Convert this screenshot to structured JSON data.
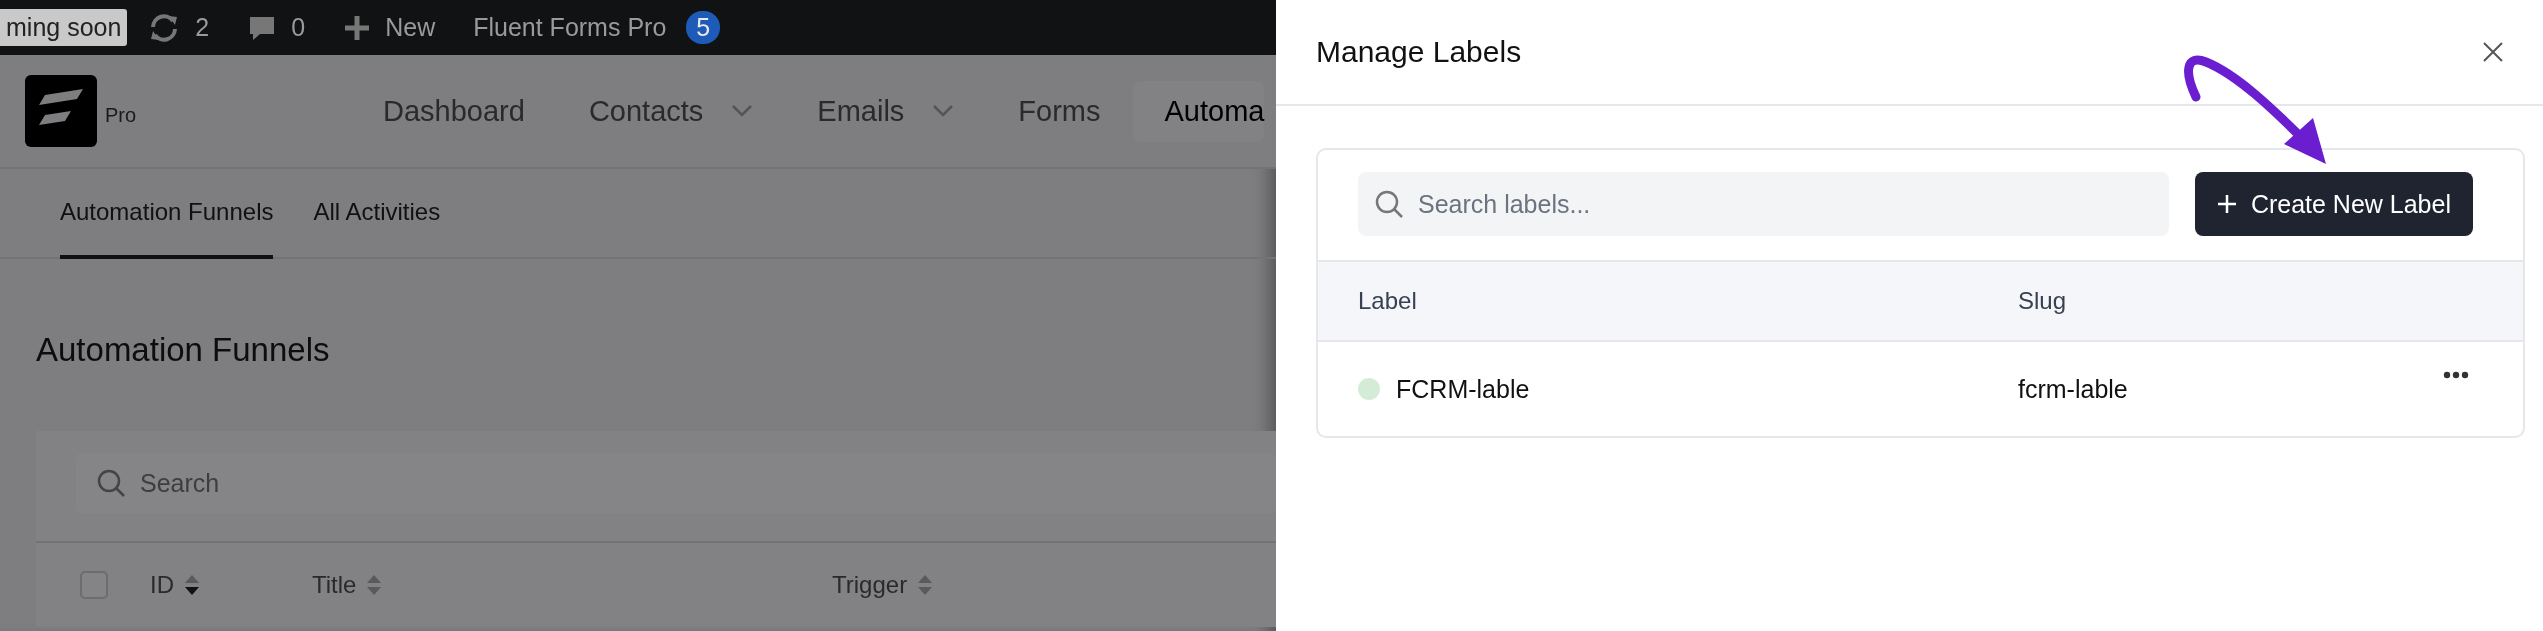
{
  "admin_bar": {
    "items": [
      {
        "kind": "badge",
        "label": "ming soon"
      },
      {
        "kind": "updates",
        "label": "2"
      },
      {
        "kind": "comments",
        "label": "0"
      },
      {
        "kind": "new",
        "label": "New"
      },
      {
        "kind": "plugin",
        "label": "Fluent Forms Pro",
        "count": "5"
      }
    ]
  },
  "app_nav": {
    "logo_label": "Pro",
    "items": [
      {
        "label": "Dashboard",
        "dropdown": false,
        "selected": false
      },
      {
        "label": "Contacts",
        "dropdown": true,
        "selected": false
      },
      {
        "label": "Emails",
        "dropdown": true,
        "selected": false
      },
      {
        "label": "Forms",
        "dropdown": false,
        "selected": false
      },
      {
        "label": "Automa",
        "dropdown": false,
        "selected": true
      }
    ]
  },
  "sub_tabs": [
    {
      "label": "Automation Funnels",
      "selected": true
    },
    {
      "label": "All Activities",
      "selected": false
    }
  ],
  "page_title": "Automation Funnels",
  "search": {
    "placeholder": "Search"
  },
  "table": {
    "select_all_checked": false,
    "columns": [
      {
        "label": "ID",
        "sorted": true
      },
      {
        "label": "Title",
        "sorted": false
      },
      {
        "label": "Trigger",
        "sorted": false
      }
    ]
  },
  "drawer": {
    "title": "Manage Labels",
    "search": {
      "placeholder": "Search labels..."
    },
    "create_button": "Create New Label",
    "columns": [
      "Label",
      "Slug"
    ],
    "rows": [
      {
        "label": "FCRM-lable",
        "slug": "fcrm-lable",
        "color": "#d4ecd5"
      }
    ]
  }
}
